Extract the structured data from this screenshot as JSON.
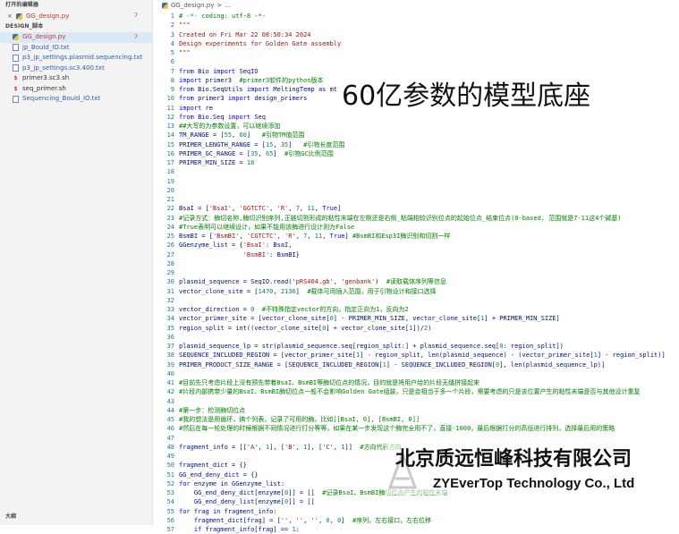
{
  "sidebar": {
    "open_editors_title": "打开的编辑器",
    "open_editor": {
      "close": "×",
      "name": "GG_design.py",
      "badge": "7"
    },
    "explorer_title": "DESIGN_脚本",
    "files": [
      {
        "name": "GG_design.py",
        "type": "py",
        "color": "red",
        "badge": "7",
        "selected": true
      },
      {
        "name": "jp_Bould_IO.txt",
        "type": "txt",
        "color": "blue",
        "badge": ""
      },
      {
        "name": "p3_jp_settings.plasmid.sequencing.txt",
        "type": "txt",
        "color": "blue",
        "badge": ""
      },
      {
        "name": "p3_jp_settings.sc3.400.txt",
        "type": "txt",
        "color": "blue",
        "badge": ""
      },
      {
        "name": "primer3.sc3.sh",
        "type": "sh",
        "color": "dark",
        "badge": ""
      },
      {
        "name": "seq_primer.sh",
        "type": "sh",
        "color": "dark",
        "badge": ""
      },
      {
        "name": "Sequencing_Bould_IO.txt",
        "type": "txt",
        "color": "blue",
        "badge": ""
      }
    ],
    "outline_title": "大纲"
  },
  "breadcrumb": {
    "file": "GG_design.py",
    "sep": ">",
    "more": "..."
  },
  "overlay": {
    "title": "60亿参数的模型底座",
    "company_cn": "北京质远恒峰科技有限公司",
    "company_en": "ZYEverTop Technology Co., Ltd"
  },
  "code_lines": [
    {
      "n": "1",
      "parts": [
        [
          "c",
          "# -*- coding: utf-8 -*-"
        ]
      ]
    },
    {
      "n": "2",
      "parts": [
        [
          "s",
          "\"\"\""
        ]
      ]
    },
    {
      "n": "3",
      "parts": [
        [
          "s",
          "Created on Fri Mar 22 08:50:34 2024"
        ]
      ]
    },
    {
      "n": "4",
      "parts": [
        [
          "s",
          "Design experiments for Golden Gate assembly"
        ]
      ]
    },
    {
      "n": "5",
      "parts": [
        [
          "s",
          "\"\"\""
        ]
      ]
    },
    {
      "n": "6",
      "parts": []
    },
    {
      "n": "7",
      "parts": [
        [
          "k",
          "from "
        ],
        [
          "p",
          "Bio "
        ],
        [
          "k",
          "import "
        ],
        [
          "p",
          "SeqIO"
        ]
      ]
    },
    {
      "n": "8",
      "parts": [
        [
          "k",
          "import "
        ],
        [
          "p",
          "primer3  "
        ],
        [
          "c",
          "#primer3软件的python版本"
        ]
      ]
    },
    {
      "n": "9",
      "parts": [
        [
          "k",
          "from "
        ],
        [
          "p",
          "Bio.SeqUtils "
        ],
        [
          "k",
          "import "
        ],
        [
          "p",
          "MeltingTemp "
        ],
        [
          "k",
          "as "
        ],
        [
          "p",
          "mt"
        ]
      ]
    },
    {
      "n": "10",
      "parts": [
        [
          "k",
          "from "
        ],
        [
          "p",
          "primer3 "
        ],
        [
          "k",
          "import "
        ],
        [
          "p",
          "design_primers"
        ]
      ]
    },
    {
      "n": "11",
      "parts": [
        [
          "k",
          "import "
        ],
        [
          "p",
          "re"
        ]
      ]
    },
    {
      "n": "12",
      "parts": [
        [
          "k",
          "from "
        ],
        [
          "p",
          "Bio.Seq "
        ],
        [
          "k",
          "import "
        ],
        [
          "p",
          "Seq"
        ]
      ]
    },
    {
      "n": "13",
      "parts": [
        [
          "c",
          "##大写的为参数设置，可以继续添加"
        ]
      ]
    },
    {
      "n": "14",
      "parts": [
        [
          "p",
          "TM_RANGE = ["
        ],
        [
          "n",
          "55"
        ],
        [
          "p",
          ", "
        ],
        [
          "n",
          "60"
        ],
        [
          "p",
          "]   "
        ],
        [
          "c",
          "#引物TM值范围"
        ]
      ]
    },
    {
      "n": "15",
      "parts": [
        [
          "p",
          "PRIMER_LENGTH_RANGE = ["
        ],
        [
          "n",
          "15"
        ],
        [
          "p",
          ", "
        ],
        [
          "n",
          "35"
        ],
        [
          "p",
          "]   "
        ],
        [
          "c",
          "#引物长度范围"
        ]
      ]
    },
    {
      "n": "16",
      "parts": [
        [
          "p",
          "PRIMER_GC_RANGE = ["
        ],
        [
          "n",
          "35"
        ],
        [
          "p",
          ", "
        ],
        [
          "n",
          "65"
        ],
        [
          "p",
          "]  "
        ],
        [
          "c",
          "#引物GC比例范围"
        ]
      ]
    },
    {
      "n": "17",
      "parts": [
        [
          "p",
          "PRIMER_MIN_SIZE = "
        ],
        [
          "n",
          "18"
        ]
      ]
    },
    {
      "n": "18",
      "parts": []
    },
    {
      "n": "19",
      "parts": []
    },
    {
      "n": "20",
      "parts": []
    },
    {
      "n": "21",
      "parts": []
    },
    {
      "n": "22",
      "parts": [
        [
          "p",
          "BsaI = ["
        ],
        [
          "s",
          "'BsaI'"
        ],
        [
          "p",
          ", "
        ],
        [
          "s",
          "'GGTCTC'"
        ],
        [
          "p",
          ", "
        ],
        [
          "s",
          "'R'"
        ],
        [
          "p",
          ", "
        ],
        [
          "n",
          "7"
        ],
        [
          "p",
          ", "
        ],
        [
          "n",
          "11"
        ],
        [
          "p",
          ", "
        ],
        [
          "k",
          "True"
        ],
        [
          "p",
          "]"
        ]
      ]
    },
    {
      "n": "23",
      "parts": [
        [
          "c",
          "#记录方式：酶切名称,酶切识别序列,正链切割形成的粘性末端在左侧还是右侧_粘端相较识别位点的起始位点_结束位点(0-based, 范围就是7-11这4个碱基)"
        ]
      ]
    },
    {
      "n": "24",
      "parts": [
        [
          "c",
          "#True表明可以继续设计，如果不能用该酶进行设计则为False"
        ]
      ]
    },
    {
      "n": "25",
      "parts": [
        [
          "p",
          "BsmBI = ["
        ],
        [
          "s",
          "'BsmBI'"
        ],
        [
          "p",
          ", "
        ],
        [
          "s",
          "'CGTCTC'"
        ],
        [
          "p",
          ", "
        ],
        [
          "s",
          "'R'"
        ],
        [
          "p",
          ", "
        ],
        [
          "n",
          "7"
        ],
        [
          "p",
          ", "
        ],
        [
          "n",
          "11"
        ],
        [
          "p",
          ", "
        ],
        [
          "k",
          "True"
        ],
        [
          "p",
          "] "
        ],
        [
          "c",
          "#BsmBI和Esp3I酶识别和切割一样"
        ]
      ]
    },
    {
      "n": "26",
      "parts": [
        [
          "p",
          "GGenzyme_list = {"
        ],
        [
          "s",
          "'BsaI'"
        ],
        [
          "p",
          ": BsaI,"
        ]
      ]
    },
    {
      "n": "27",
      "parts": [
        [
          "p",
          "                 "
        ],
        [
          "s",
          "'BsmBI'"
        ],
        [
          "p",
          ": BsmBI}"
        ]
      ]
    },
    {
      "n": "28",
      "parts": []
    },
    {
      "n": "29",
      "parts": []
    },
    {
      "n": "30",
      "parts": [
        [
          "p",
          "plasmid_sequence = SeqIO.read("
        ],
        [
          "s",
          "'pRS404.gb'"
        ],
        [
          "p",
          ", "
        ],
        [
          "s",
          "'genbank'"
        ],
        [
          "p",
          ")  "
        ],
        [
          "c",
          "#读取载体序列等信息"
        ]
      ]
    },
    {
      "n": "31",
      "parts": [
        [
          "p",
          "vector_clone_site = ["
        ],
        [
          "n",
          "1470"
        ],
        [
          "p",
          ", "
        ],
        [
          "n",
          "2136"
        ],
        [
          "p",
          "]  "
        ],
        [
          "c",
          "#载体可用插入范围，用于引物设计和接口选择"
        ]
      ]
    },
    {
      "n": "32",
      "parts": []
    },
    {
      "n": "33",
      "parts": [
        [
          "p",
          "vector_direction = "
        ],
        [
          "n",
          "0"
        ],
        [
          "p",
          "  "
        ],
        [
          "c",
          "#不特殊指定vector的方向，指定正向为1，反向为2"
        ]
      ]
    },
    {
      "n": "34",
      "parts": [
        [
          "p",
          "vector_primer_site = [vector_clone_site["
        ],
        [
          "n",
          "0"
        ],
        [
          "p",
          "] - PRIMER_MIN_SIZE, vector_clone_site["
        ],
        [
          "n",
          "1"
        ],
        [
          "p",
          "] + PRIMER_MIN_SIZE]"
        ]
      ]
    },
    {
      "n": "35",
      "parts": [
        [
          "p",
          "region_split = int((vector_clone_site["
        ],
        [
          "n",
          "0"
        ],
        [
          "p",
          "] + vector_clone_site["
        ],
        [
          "n",
          "1"
        ],
        [
          "p",
          "])/"
        ],
        [
          "n",
          "2"
        ],
        [
          "p",
          ")"
        ]
      ]
    },
    {
      "n": "36",
      "parts": []
    },
    {
      "n": "37",
      "parts": [
        [
          "p",
          "plasmid_sequence_lp = str(plasmid_sequence.seq[region_split:] + plasmid_sequence.seq["
        ],
        [
          "n",
          "0"
        ],
        [
          "p",
          ": region_split])"
        ]
      ]
    },
    {
      "n": "38",
      "parts": [
        [
          "p",
          "SEQUENCE_INCLUDED_REGION = [vector_primer_site["
        ],
        [
          "n",
          "1"
        ],
        [
          "p",
          "] - region_split, len(plasmid_sequence) - (vector_primer_site["
        ],
        [
          "n",
          "1"
        ],
        [
          "p",
          "] - region_split)]"
        ]
      ]
    },
    {
      "n": "39",
      "parts": [
        [
          "p",
          "PRIMER_PRODUCT_SIZE_RANGE = [SEQUENCE_INCLUDED_REGION["
        ],
        [
          "n",
          "1"
        ],
        [
          "p",
          "] - SEQUENCE_INCLUDED_REGION["
        ],
        [
          "n",
          "0"
        ],
        [
          "p",
          "], len(plasmid_sequence_lp)]"
        ]
      ]
    },
    {
      "n": "40",
      "parts": []
    },
    {
      "n": "41",
      "parts": [
        [
          "c",
          "#目前先只考虑片段上没有预先带着BsaI、BsmBI等酶切位点的情况，目的就是将用户给的片段无缝拼接起来"
        ]
      ]
    },
    {
      "n": "42",
      "parts": [
        [
          "c",
          "#片段内部携带少量的BsaI、BsmBI酶切位点一般不会影响Golden Gate组装，只是会相当于多一个片段，需要考虑的只是该位置产生的粘性末端是否与其他设计重复"
        ]
      ]
    },
    {
      "n": "43",
      "parts": []
    },
    {
      "n": "44",
      "parts": [
        [
          "c",
          "#第一步：检测酶切位点"
        ]
      ]
    },
    {
      "n": "45",
      "parts": [
        [
          "c",
          "#我的想法是用循环，搞个列表，记录了可用的酶，比如[[BsaI, 0], [BsmBI, 0]]"
        ]
      ]
    },
    {
      "n": "46",
      "parts": [
        [
          "c",
          "#然后在每一轮处理的时候根据不同情况进行打分等等，如果在某一步发现这个酶完全用不了，直接-1000，最后根据打分的高低进行排列，选择最后用的策略"
        ]
      ]
    },
    {
      "n": "47",
      "parts": []
    },
    {
      "n": "48",
      "parts": [
        [
          "p",
          "fragment_info = [["
        ],
        [
          "s",
          "'A'"
        ],
        [
          "p",
          ", "
        ],
        [
          "n",
          "1"
        ],
        [
          "p",
          "], ["
        ],
        [
          "s",
          "'B'"
        ],
        [
          "p",
          ", "
        ],
        [
          "n",
          "1"
        ],
        [
          "p",
          "], ["
        ],
        [
          "s",
          "'C'"
        ],
        [
          "p",
          ", "
        ],
        [
          "n",
          "1"
        ],
        [
          "p",
          "]]  "
        ],
        [
          "c",
          "#方向代表方向"
        ]
      ]
    },
    {
      "n": "49",
      "parts": []
    },
    {
      "n": "50",
      "parts": [
        [
          "p",
          "fragment_dict = {}"
        ]
      ]
    },
    {
      "n": "51",
      "parts": [
        [
          "p",
          "GG_end_deny_dict = {}"
        ]
      ]
    },
    {
      "n": "52",
      "parts": [
        [
          "k",
          "for "
        ],
        [
          "p",
          "enzyme "
        ],
        [
          "k",
          "in "
        ],
        [
          "p",
          "GGenzyme_list:"
        ]
      ]
    },
    {
      "n": "53",
      "parts": [
        [
          "p",
          "    GG_end_deny_dict[enzyme["
        ],
        [
          "n",
          "0"
        ],
        [
          "p",
          "]] = []  "
        ],
        [
          "c",
          "#记录BsaI、BsmBI酶切位点产生的粘性末端"
        ]
      ]
    },
    {
      "n": "54",
      "parts": [
        [
          "p",
          "    GG_end_deny_list[enzyme["
        ],
        [
          "n",
          "0"
        ],
        [
          "p",
          "]] = []"
        ]
      ]
    },
    {
      "n": "55",
      "parts": [
        [
          "k",
          "for "
        ],
        [
          "p",
          "frag "
        ],
        [
          "k",
          "in "
        ],
        [
          "p",
          "fragment_info:"
        ]
      ]
    },
    {
      "n": "56",
      "parts": [
        [
          "p",
          "    fragment_dict[frag] = ["
        ],
        [
          "s",
          "''"
        ],
        [
          "p",
          ", "
        ],
        [
          "s",
          "''"
        ],
        [
          "p",
          ", "
        ],
        [
          "s",
          "''"
        ],
        [
          "p",
          ", "
        ],
        [
          "n",
          "0"
        ],
        [
          "p",
          ", "
        ],
        [
          "n",
          "0"
        ],
        [
          "p",
          "]  "
        ],
        [
          "c",
          "#序列，左右接口，左右位移"
        ]
      ]
    },
    {
      "n": "57",
      "parts": [
        [
          "p",
          "    "
        ],
        [
          "k",
          "if "
        ],
        [
          "p",
          "fragment_info[frag] == "
        ],
        [
          "n",
          "1"
        ],
        [
          "p",
          ":"
        ]
      ]
    }
  ]
}
